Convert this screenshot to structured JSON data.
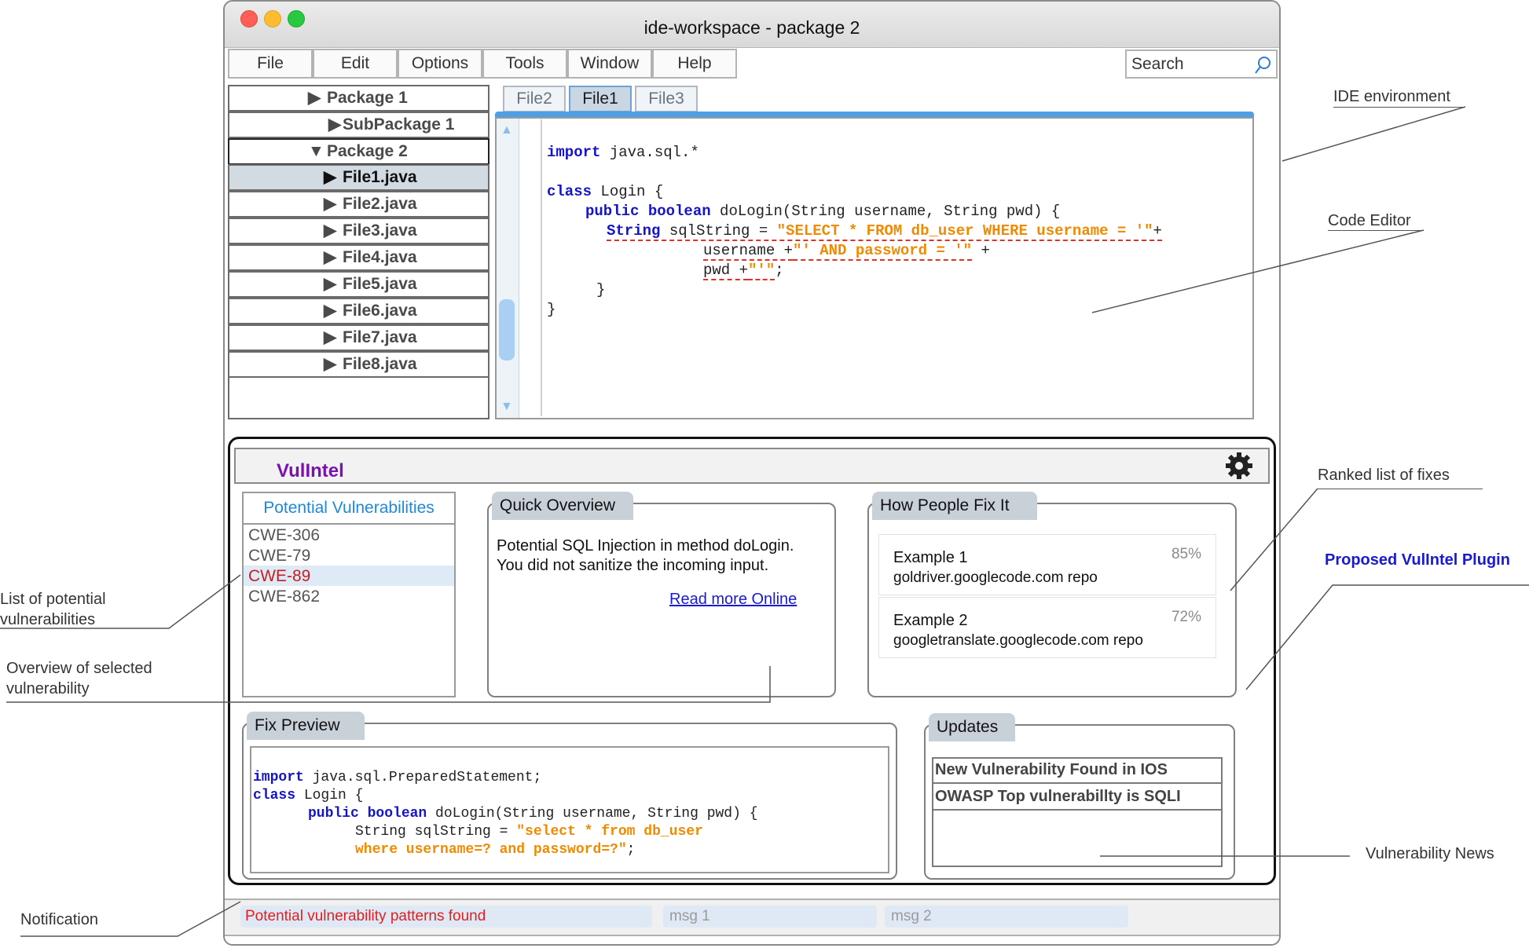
{
  "window": {
    "title": "ide-workspace - package 2"
  },
  "menu": [
    "File",
    "Edit",
    "Options",
    "Tools",
    "Window",
    "Help"
  ],
  "search": {
    "placeholder": "Search"
  },
  "tree": {
    "items": [
      "Package 1",
      "SubPackage 1",
      "Package 2",
      "File1.java",
      "File2.java",
      "File3.java",
      "File4.java",
      "File5.java",
      "File6.java",
      "File7.java",
      "File8.java"
    ],
    "arrows": [
      "▶",
      "▶",
      "▼",
      "▶",
      "▶",
      "▶",
      "▶",
      "▶",
      "▶",
      "▶",
      "▶"
    ],
    "selected": "File1.java"
  },
  "editor": {
    "tabs": [
      "File2",
      "File1",
      "File3"
    ],
    "active_tab": "File1",
    "code": {
      "l1_kw": "import",
      "l1": " java.sql.*",
      "l2_kw": "class",
      "l2": " Login {",
      "l3_kw": "public boolean",
      "l3": " doLogin(String username, String pwd) {",
      "l4_kw": "String",
      "l4": " sqlString = ",
      "l4_str": "\"SELECT * FROM db_user WHERE username = '\"",
      "l4_end": "+",
      "l5a": "username +",
      "l5_str": "\"' AND password = '\"",
      "l5_end": " +",
      "l6a": "pwd +",
      "l6_str": "\"'\"",
      "l6_end": ";",
      "l7": "}",
      "l8": "}"
    }
  },
  "plugin": {
    "name": "VulIntel",
    "potential": {
      "title": "Potential Vulnerabilities",
      "items": [
        "CWE-306",
        "CWE-79",
        "CWE-89",
        "CWE-862"
      ],
      "selected": "CWE-89"
    },
    "overview": {
      "title": "Quick Overview",
      "line1": "Potential SQL Injection in method doLogin.",
      "line2": "You did not sanitize the incoming input.",
      "link": "Read more Online"
    },
    "fixes": {
      "title": "How People Fix It",
      "items": [
        {
          "name": "Example 1",
          "repo": "goldriver.googlecode.com repo",
          "score": "85%"
        },
        {
          "name": "Example 2",
          "repo": "googletranslate.googlecode.com repo",
          "score": "72%"
        }
      ]
    },
    "preview": {
      "title": "Fix Preview",
      "p1_kw": "import",
      "p1": " java.sql.PreparedStatement;",
      "p2_kw": "class",
      "p2": " Login {",
      "p3_kw": "public boolean",
      "p3": " doLogin(String username, String pwd) {",
      "p4": "String sqlString = ",
      "p4_str": "\"select * from db_user",
      "p5_str": "where username=? and password=?\"",
      "p5_end": ";"
    },
    "updates": {
      "title": "Updates",
      "items": [
        "New Vulnerability Found in IOS",
        "OWASP Top vulnerabillty is SQLI"
      ]
    }
  },
  "status": {
    "items": [
      "Potential vulnerability patterns found",
      "msg 1",
      "msg 2"
    ]
  },
  "annotations": {
    "ide": "IDE environment",
    "editor": "Code Editor",
    "fixes": "Ranked list of fixes",
    "plugin": "Proposed VulIntel Plugin",
    "list1": "List of potential",
    "list2": "vulnerabilities",
    "overview1": "Overview of selected",
    "overview2": "vulnerability",
    "news": "Vulnerability News",
    "notification": "Notification"
  },
  "colors": {
    "keyword": "#1515c8",
    "string": "#f08a00",
    "error": "#e0302a",
    "plugin_name": "#7a12b0",
    "link": "#1a1ad0",
    "list_title": "#1e8ad6"
  }
}
